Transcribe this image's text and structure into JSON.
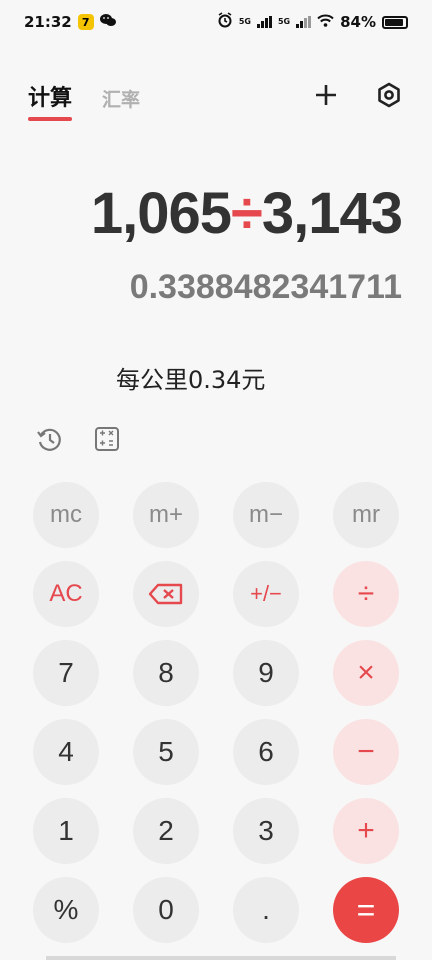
{
  "status_bar": {
    "time": "21:32",
    "app_badge": "7",
    "wechat_icon": "wechat-icon",
    "signal1_label": "5G",
    "signal2_label": "5G",
    "battery": "84%"
  },
  "tabs": [
    {
      "label": "计算",
      "active": true
    },
    {
      "label": "汇率",
      "active": false
    }
  ],
  "display": {
    "operand1": "1,065",
    "operator": "÷",
    "operand2": "3,143",
    "result": "0.3388482341711",
    "hint": "每公里0.34元"
  },
  "keys": {
    "mc": "mc",
    "mplus": "m+",
    "mminus": "m−",
    "mr": "mr",
    "ac": "AC",
    "plusminus": "+/−",
    "divide": "÷",
    "k7": "7",
    "k8": "8",
    "k9": "9",
    "multiply": "×",
    "k4": "4",
    "k5": "5",
    "k6": "6",
    "minus": "−",
    "k1": "1",
    "k2": "2",
    "k3": "3",
    "plus": "+",
    "percent": "%",
    "k0": "0",
    "dot": ".",
    "equals": "="
  },
  "colors": {
    "accent": "#e5484d",
    "op_bg": "#fbe2e2",
    "equals_bg": "#ea4646",
    "key_bg": "#ececec",
    "background": "#f7f7f7"
  }
}
